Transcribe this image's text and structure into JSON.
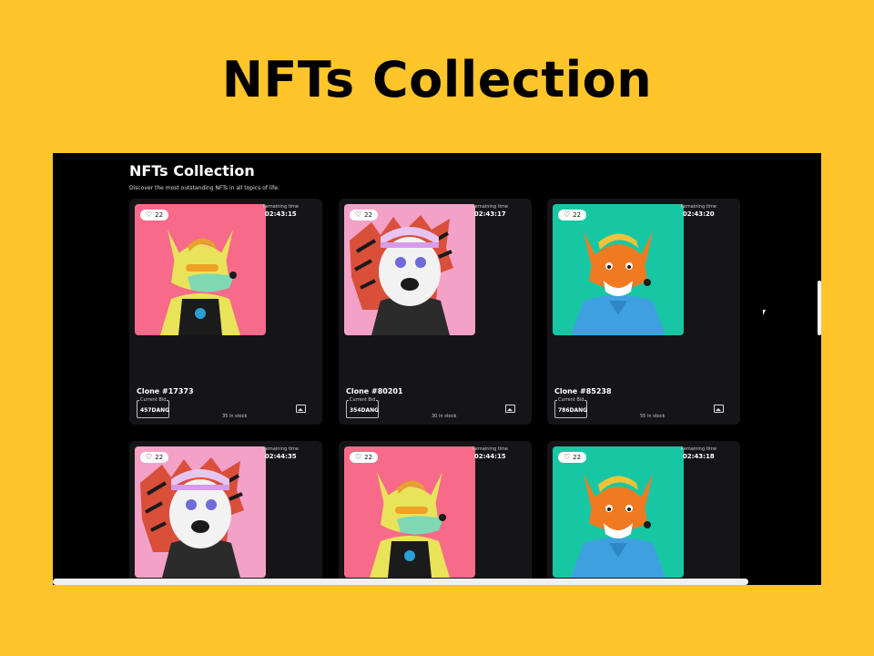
{
  "slide": {
    "title": "NFTs Collection"
  },
  "page": {
    "heading": "NFTs Collection",
    "subtitle": "Discover the most outstanding NFTs in all topics of life."
  },
  "cards": [
    {
      "likes": "22",
      "timer_label": "Remaining time",
      "timer": "02:43:15",
      "name": "Clone #17373",
      "bid_label": "Current Bid",
      "bid": "457DANG",
      "stock": "35 in stock",
      "art": "pink-fox",
      "art_bg": "#F76A89"
    },
    {
      "likes": "22",
      "timer_label": "Remaining time",
      "timer": "02:43:17",
      "name": "Clone #80201",
      "bid_label": "Current Bid",
      "bid": "354DANG",
      "stock": "30 in stock",
      "art": "polar-bear",
      "art_bg": "#F4A1C8"
    },
    {
      "likes": "22",
      "timer_label": "Remaining time",
      "timer": "02:43:20",
      "name": "Clone #85238",
      "bid_label": "Current Bid",
      "bid": "786DANG",
      "stock": "55 in stock",
      "art": "teal-fox",
      "art_bg": "#17C7A3"
    },
    {
      "likes": "22",
      "timer_label": "Remaining time",
      "timer": "02:44:35",
      "art": "polar-bear",
      "art_bg": "#F4A1C8"
    },
    {
      "likes": "22",
      "timer_label": "Remaining time",
      "timer": "02:44:15",
      "art": "pink-fox",
      "art_bg": "#F76A89"
    },
    {
      "likes": "22",
      "timer_label": "Remaining time",
      "timer": "02:43:18",
      "art": "teal-fox",
      "art_bg": "#17C7A3"
    }
  ],
  "colors": {
    "slide_bg": "#FFC52A",
    "screen_bg": "#000000",
    "card_bg": "#151518"
  },
  "icons": {
    "like": "heart-icon",
    "image": "image-icon"
  }
}
